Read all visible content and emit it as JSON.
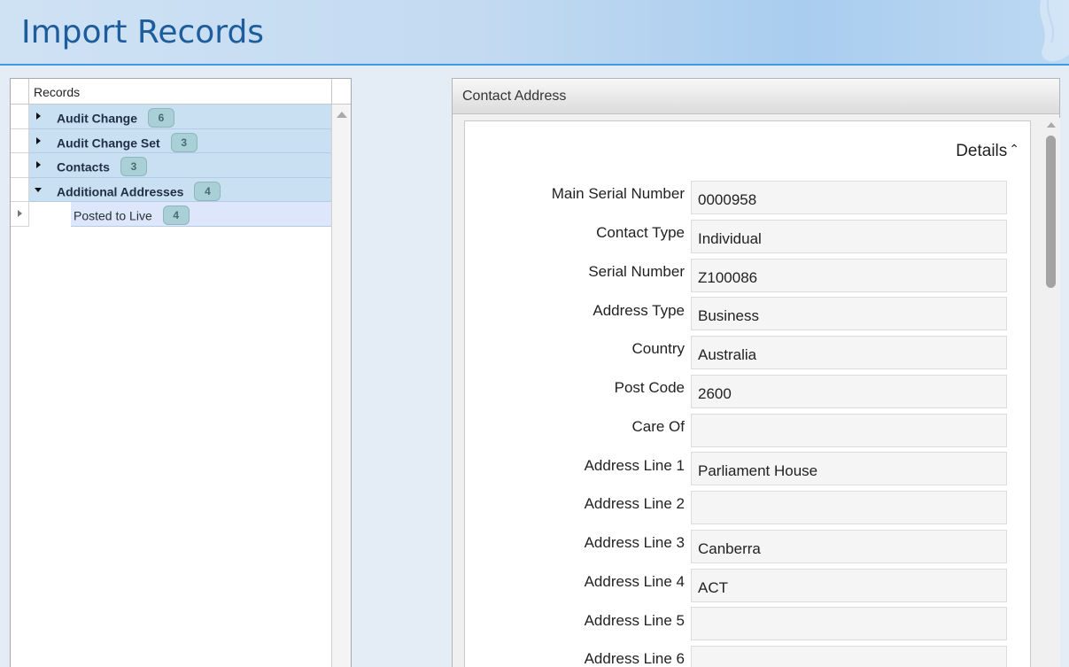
{
  "header": {
    "title": "Import Records"
  },
  "tree": {
    "column_header": "Records",
    "rows": [
      {
        "label": "Audit Change",
        "count": "6",
        "expanded": false
      },
      {
        "label": "Audit Change Set",
        "count": "3",
        "expanded": false
      },
      {
        "label": "Contacts",
        "count": "3",
        "expanded": false
      },
      {
        "label": "Additional Addresses",
        "count": "4",
        "expanded": true
      },
      {
        "label": "Posted to Live",
        "count": "4",
        "child": true
      }
    ]
  },
  "panel": {
    "title": "Contact Address",
    "details_label": "Details",
    "fields": [
      {
        "label": "Main Serial Number",
        "value": "0000958"
      },
      {
        "label": "Contact Type",
        "value": "Individual"
      },
      {
        "label": "Serial Number",
        "value": "Z100086"
      },
      {
        "label": "Address Type",
        "value": "Business"
      },
      {
        "label": "Country",
        "value": "Australia"
      },
      {
        "label": "Post Code",
        "value": "2600"
      },
      {
        "label": "Care Of",
        "value": ""
      },
      {
        "label": "Address Line 1",
        "value": "Parliament House"
      },
      {
        "label": "Address Line 2",
        "value": ""
      },
      {
        "label": "Address Line 3",
        "value": "Canberra"
      },
      {
        "label": "Address Line 4",
        "value": "ACT"
      },
      {
        "label": "Address Line 5",
        "value": ""
      },
      {
        "label": "Address Line 6",
        "value": ""
      }
    ]
  },
  "icons": {
    "expand": "triangle-right-icon",
    "collapse": "triangle-down-icon",
    "details_toggle": "chevron-up-icon",
    "scroll_up": "scroll-up-arrow-icon"
  },
  "colors": {
    "header_text": "#1d5d9c",
    "header_border": "#3f9be0",
    "tree_row_bg": "#c9dff2",
    "tree_child_bg": "#dde6fb",
    "badge_bg": "#a8d0d6"
  }
}
